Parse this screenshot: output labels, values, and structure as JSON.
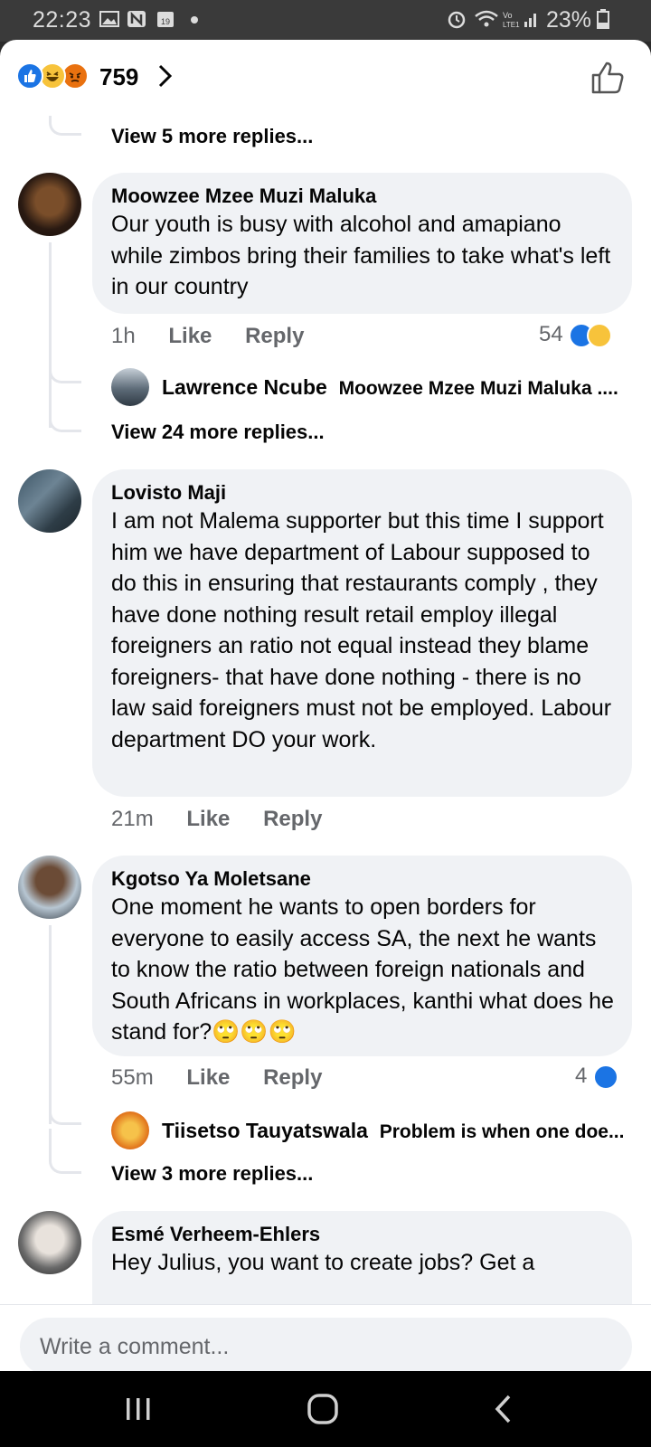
{
  "status": {
    "time": "22:23",
    "battery_pct": "23%",
    "calendar_day": "19"
  },
  "reactions": {
    "count": "759",
    "types": [
      "like-icon",
      "haha-icon",
      "angry-icon"
    ]
  },
  "comments": [
    {
      "author": "Moowzee Mzee Muzi Maluka",
      "text": "Our youth is busy with alcohol and amapiano while zimbos bring their families to take what's left in our country",
      "time": "1h",
      "like": "Like",
      "reply": "Reply",
      "reaction_count": "54",
      "reply_preview": {
        "author": "Lawrence Ncube",
        "text": "Moowzee Mzee Muzi Maluka ...."
      },
      "more_replies": "View 24 more replies..."
    },
    {
      "author": "Lovisto Maji",
      "text": "I am not Malema supporter but this time I support him we have department of Labour supposed to do this in ensuring that restaurants comply  , they have done nothing result retail employ illegal foreigners an ratio not equal  instead they blame foreigners- that have done nothing - there is no law said foreigners must not be employed.  Labour department DO your work.",
      "time": "21m",
      "like": "Like",
      "reply": "Reply"
    },
    {
      "author": "Kgotso Ya Moletsane",
      "text": "One moment he wants to open borders for everyone to easily access SA, the next he wants to know the ratio between foreign nationals and South Africans in workplaces, kanthi  what does he stand for?",
      "emoji": "🙄🙄🙄",
      "time": "55m",
      "like": "Like",
      "reply": "Reply",
      "reaction_count": "4",
      "reply_preview": {
        "author": "Tiisetso Tauyatswala",
        "text": "Problem is when one doe..."
      },
      "more_replies": "View 3 more replies..."
    },
    {
      "author": "Esmé Verheem-Ehlers",
      "text": "Hey Julius, you want to create jobs? Get a"
    }
  ],
  "top_more_replies": "View 5 more replies...",
  "composer": {
    "placeholder": "Write a comment..."
  },
  "colors": {
    "accent": "#1b74e4",
    "bubble": "#f0f2f5",
    "muted": "#65676b"
  }
}
